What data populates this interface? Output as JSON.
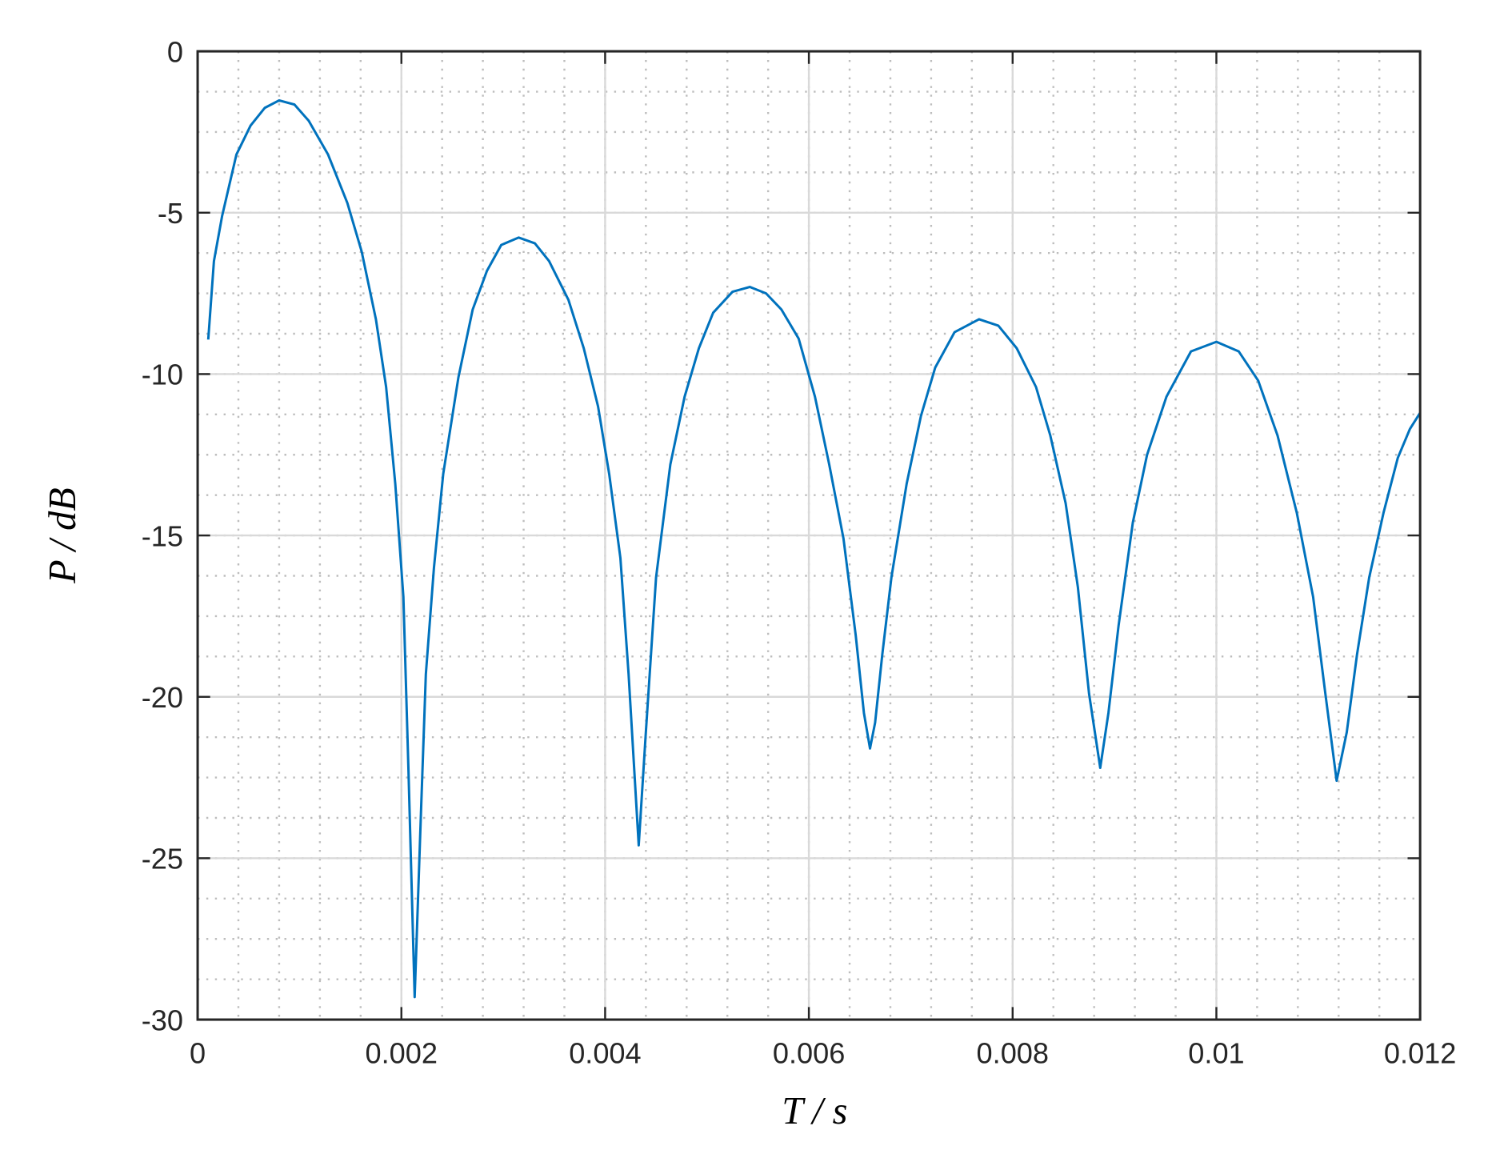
{
  "chart_data": {
    "type": "line",
    "title": "",
    "xlabel": "T  / s",
    "ylabel": "P  / dB",
    "xlim": [
      0,
      0.012
    ],
    "ylim": [
      -30,
      0
    ],
    "grid": true,
    "minor_grid": true,
    "xticks": [
      0,
      0.002,
      0.004,
      0.006,
      0.008,
      0.01,
      0.012
    ],
    "xtick_labels": [
      "0",
      "0.002",
      "0.004",
      "0.006",
      "0.008",
      "0.01",
      "0.012"
    ],
    "yticks": [
      0,
      -5,
      -10,
      -15,
      -20,
      -25,
      -30
    ],
    "ytick_labels": [
      "0",
      "-5",
      "-10",
      "-15",
      "-20",
      "-25",
      "-30"
    ],
    "series": [
      {
        "name": "P",
        "color": "#0072BD",
        "x": [
          0.000104,
          0.00016,
          0.00024,
          0.00038,
          0.00052,
          0.00066,
          0.0008,
          0.00095,
          0.00109,
          0.00128,
          0.00147,
          0.00161,
          0.00175,
          0.00185,
          0.00194,
          0.00202,
          0.00207,
          0.00213,
          0.00219,
          0.00224,
          0.00232,
          0.00241,
          0.00256,
          0.0027,
          0.00284,
          0.00298,
          0.00315,
          0.00331,
          0.00345,
          0.00364,
          0.00379,
          0.00393,
          0.00404,
          0.00415,
          0.00423,
          0.00433,
          0.0044,
          0.0045,
          0.00464,
          0.00478,
          0.00492,
          0.00506,
          0.00525,
          0.00542,
          0.00558,
          0.00573,
          0.0059,
          0.00606,
          0.0062,
          0.00634,
          0.00646,
          0.00654,
          0.0066,
          0.00665,
          0.00672,
          0.00681,
          0.00696,
          0.0071,
          0.00724,
          0.00743,
          0.00767,
          0.00786,
          0.00804,
          0.00823,
          0.00837,
          0.00852,
          0.00864,
          0.00875,
          0.00886,
          0.00894,
          0.00904,
          0.00918,
          0.00932,
          0.00951,
          0.00975,
          0.01,
          0.01022,
          0.01041,
          0.0106,
          0.01079,
          0.01095,
          0.01107,
          0.01118,
          0.01128,
          0.01138,
          0.0115,
          0.01164,
          0.01178,
          0.0119,
          0.012
        ],
        "y": [
          -8.93,
          -6.5,
          -5.1,
          -3.2,
          -2.3,
          -1.75,
          -1.52,
          -1.65,
          -2.15,
          -3.2,
          -4.7,
          -6.2,
          -8.3,
          -10.4,
          -13.4,
          -16.9,
          -22.3,
          -29.3,
          -23.8,
          -19.3,
          -16.0,
          -13.1,
          -10.1,
          -8.0,
          -6.8,
          -6.0,
          -5.77,
          -5.95,
          -6.5,
          -7.7,
          -9.2,
          -11.0,
          -13.1,
          -15.7,
          -19.3,
          -24.6,
          -21.1,
          -16.3,
          -12.8,
          -10.7,
          -9.2,
          -8.1,
          -7.45,
          -7.3,
          -7.5,
          -8.0,
          -8.9,
          -10.7,
          -12.8,
          -15.1,
          -18.1,
          -20.5,
          -21.6,
          -20.8,
          -18.7,
          -16.3,
          -13.4,
          -11.3,
          -9.8,
          -8.7,
          -8.3,
          -8.5,
          -9.2,
          -10.4,
          -11.9,
          -14.0,
          -16.6,
          -19.9,
          -22.2,
          -20.5,
          -17.8,
          -14.6,
          -12.5,
          -10.7,
          -9.3,
          -9.0,
          -9.3,
          -10.2,
          -11.9,
          -14.3,
          -16.9,
          -19.9,
          -22.6,
          -21.1,
          -18.7,
          -16.3,
          -14.3,
          -12.6,
          -11.7,
          -11.2
        ]
      }
    ]
  }
}
